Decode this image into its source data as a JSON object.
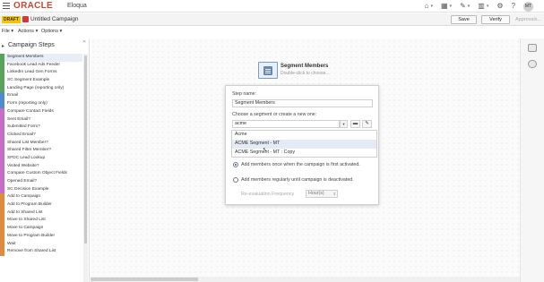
{
  "header": {
    "brand": "ORACLE",
    "product": "Eloqua",
    "avatar_initials": "MT",
    "icons": [
      "home-icon",
      "grid-icon",
      "pen-icon",
      "chart-icon",
      "gear-icon",
      "help-icon"
    ]
  },
  "campaign_bar": {
    "status": "DRAFT",
    "title": "Untitled Campaign",
    "save_label": "Save",
    "verify_label": "Verify",
    "approvals_label": "Approvals..."
  },
  "menu": {
    "file": "File ▾",
    "actions": "Actions ▾",
    "options": "Options ▾"
  },
  "left_panel": {
    "title": "Campaign Steps",
    "items": [
      {
        "label": "Segment Members",
        "color": "#5ba35b"
      },
      {
        "label": "Facebook Lead Ads Feeder",
        "color": "#5ba35b"
      },
      {
        "label": "LinkedIn Lead Gen Forms",
        "color": "#5ba35b"
      },
      {
        "label": "SC Segment Example",
        "color": "#5ba35b"
      },
      {
        "label": "Landing Page (reporting only)",
        "color": "#5ba35b"
      },
      {
        "label": "Email",
        "color": "#4f8ccd"
      },
      {
        "label": "Form (reporting only)",
        "color": "#4f8ccd"
      },
      {
        "label": "Compare Contact Fields",
        "color": "#c96bc9"
      },
      {
        "label": "Sent Email?",
        "color": "#c96bc9"
      },
      {
        "label": "Submitted Form?",
        "color": "#c96bc9"
      },
      {
        "label": "Clicked Email?",
        "color": "#c96bc9"
      },
      {
        "label": "Shared List Member?",
        "color": "#c96bc9"
      },
      {
        "label": "Shared Filter Member?",
        "color": "#c96bc9"
      },
      {
        "label": "SFDC Lead Lookup",
        "color": "#c96bc9"
      },
      {
        "label": "Visited Website?",
        "color": "#c96bc9"
      },
      {
        "label": "Compare Custom Object Fields",
        "color": "#c96bc9"
      },
      {
        "label": "Opened Email?",
        "color": "#c96bc9"
      },
      {
        "label": "SC Decision Example",
        "color": "#c96bc9"
      },
      {
        "label": "Add to Campaign",
        "color": "#e08a3c"
      },
      {
        "label": "Add to Program Builder",
        "color": "#e08a3c"
      },
      {
        "label": "Add to Shared List",
        "color": "#e08a3c"
      },
      {
        "label": "Move to Shared List",
        "color": "#e08a3c"
      },
      {
        "label": "Move to Campaign",
        "color": "#e08a3c"
      },
      {
        "label": "Move to Program Builder",
        "color": "#e08a3c"
      },
      {
        "label": "Wait",
        "color": "#e08a3c"
      },
      {
        "label": "Remove from Shared List",
        "color": "#e08a3c"
      }
    ]
  },
  "canvas": {
    "step_title": "Segment Members",
    "step_subtitle": "Double-click to choose..."
  },
  "popup": {
    "step_name_label": "Step name:",
    "step_name_value": "Segment Members",
    "choose_label": "Choose a segment or create a new one:",
    "search_value": "acme",
    "options": [
      "Acme",
      "ACME Segment - MT",
      "ACME Segment - MT : Copy"
    ],
    "highlighted_index": 1,
    "radio_once": "Add members once when the campaign is first activated.",
    "radio_regular": "Add members regularly until campaign is deactivated.",
    "reeval_label": "Re-evaluation Frequency",
    "reeval_value": "Hour(s)"
  }
}
